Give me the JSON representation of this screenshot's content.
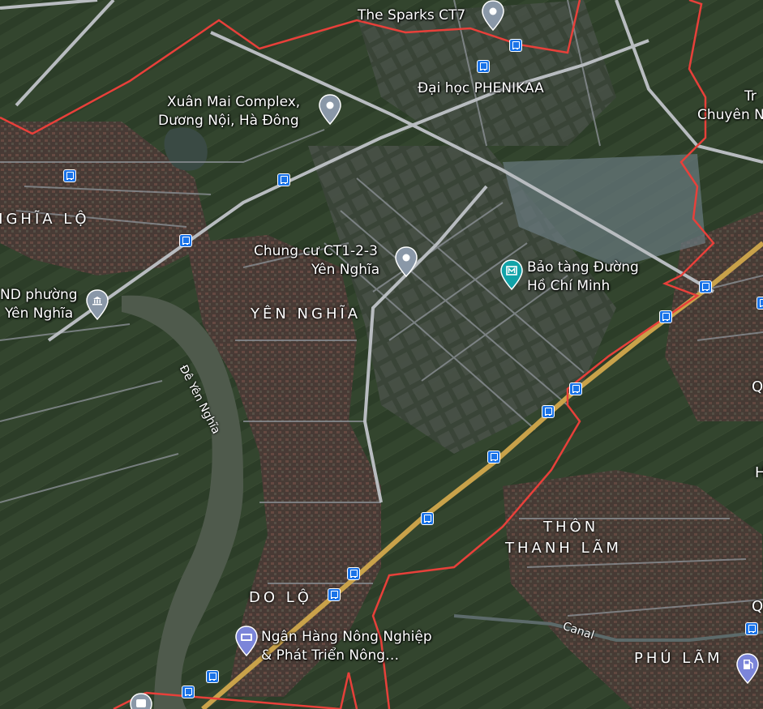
{
  "places": {
    "sparks": "The Sparks CT7",
    "phenikaa": "Đại học PHENIKAA",
    "xuan_mai_1": "Xuân Mai Complex,",
    "xuan_mai_2": "Dương Nội, Hà Đông",
    "chung_cu_1": "Chung cư CT1-2-3",
    "chung_cu_2": "Yên Nghĩa",
    "bao_tang_1": "Bảo tàng Đường",
    "bao_tang_2": "Hồ Chí Minh",
    "ubnd_1": "ND phường",
    "ubnd_2": "Yên Nghĩa",
    "chuyen": "Chuyên N",
    "tr": "Tr",
    "bank_1": "Ngân Hàng Nông Nghiệp",
    "bank_2": "& Phát Triển Nông…"
  },
  "areas": {
    "nghia_lo": "NGHĨA LỘ",
    "yen_nghia": "YÊN NGHĨA",
    "thon_1": "THÔN",
    "thon_2": "THANH LÃM",
    "do_lo": "DO LỘ",
    "phu_lam": "PHÚ LÃM",
    "q1": "Q",
    "q2": "Q",
    "h": "H"
  },
  "roads": {
    "de_yen_nghia": "Đê Yên Nghĩa",
    "canal": "Canal"
  },
  "colors": {
    "boundary": "#e8403a",
    "bus_stop": "#1a73e8",
    "pin": "#8a98a8",
    "poi_museum": "#12a3a8",
    "poi_bank": "#7b85d9"
  }
}
